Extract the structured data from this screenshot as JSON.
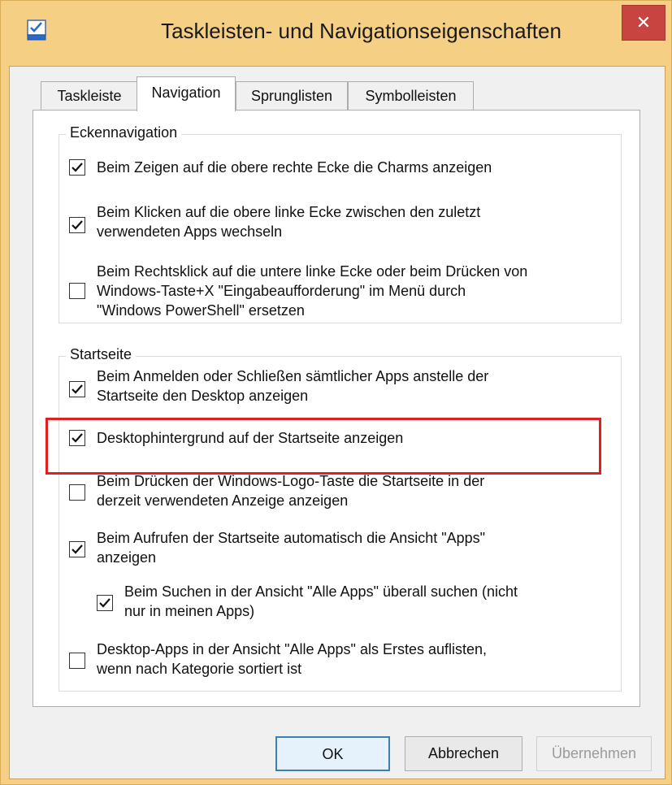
{
  "window": {
    "title": "Taskleisten- und Navigationseigenschaften",
    "close_glyph": "✕"
  },
  "tabs": [
    {
      "label": "Taskleiste",
      "active": false
    },
    {
      "label": "Navigation",
      "active": true
    },
    {
      "label": "Sprunglisten",
      "active": false
    },
    {
      "label": "Symbolleisten",
      "active": false
    }
  ],
  "groups": {
    "corner": {
      "title": "Eckennavigation",
      "options": [
        {
          "label": "Beim Zeigen auf die obere rechte Ecke die Charms anzeigen",
          "checked": true
        },
        {
          "label": "Beim Klicken auf die obere linke Ecke zwischen den zuletzt\nverwendeten Apps wechseln",
          "checked": true
        },
        {
          "label": "Beim Rechtsklick auf die untere linke Ecke oder beim Drücken von\nWindows-Taste+X \"Eingabeaufforderung\" im Menü durch\n\"Windows PowerShell\" ersetzen",
          "checked": false
        }
      ]
    },
    "start": {
      "title": "Startseite",
      "options": [
        {
          "label": "Beim Anmelden oder Schließen sämtlicher Apps anstelle der\nStartseite den Desktop anzeigen",
          "checked": true
        },
        {
          "label": "Desktophintergrund auf der Startseite anzeigen",
          "checked": true
        },
        {
          "label": "Beim Drücken der Windows-Logo-Taste die Startseite in der\nderzeit verwendeten Anzeige anzeigen",
          "checked": false
        },
        {
          "label": "Beim Aufrufen der Startseite automatisch die Ansicht \"Apps\"\nanzeigen",
          "checked": true
        },
        {
          "label": "Beim Suchen in der Ansicht \"Alle Apps\" überall suchen (nicht\nnur in meinen Apps)",
          "checked": true
        },
        {
          "label": "Desktop-Apps in der Ansicht \"Alle Apps\" als Erstes auflisten,\nwenn nach Kategorie sortiert ist",
          "checked": false
        }
      ]
    }
  },
  "buttons": {
    "ok": "OK",
    "cancel": "Abbrechen",
    "apply": "Übernehmen"
  },
  "colors": {
    "titlebar": "#f5cf84",
    "close": "#c74440",
    "highlight": "#e02020"
  }
}
